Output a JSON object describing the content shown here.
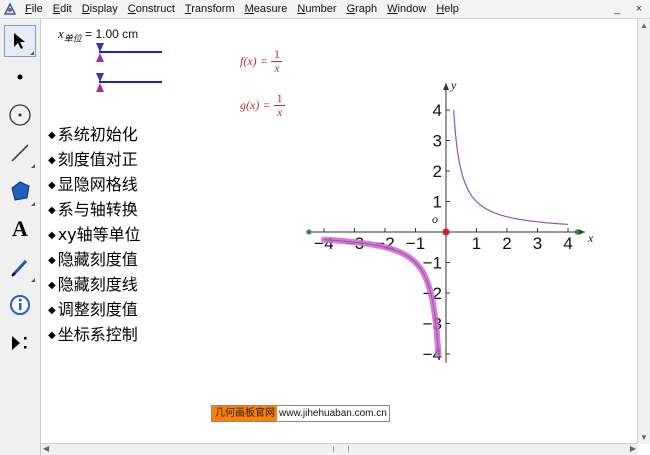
{
  "menu": {
    "items": [
      {
        "label": "File",
        "u": "F",
        "rest": "ile"
      },
      {
        "label": "Edit",
        "u": "E",
        "rest": "dit"
      },
      {
        "label": "Display",
        "u": "D",
        "rest": "isplay"
      },
      {
        "label": "Construct",
        "u": "C",
        "rest": "onstruct"
      },
      {
        "label": "Transform",
        "u": "T",
        "rest": "ransform"
      },
      {
        "label": "Measure",
        "u": "M",
        "rest": "easure"
      },
      {
        "label": "Number",
        "u": "N",
        "rest": "umber"
      },
      {
        "label": "Graph",
        "u": "G",
        "rest": "raph"
      },
      {
        "label": "Window",
        "u": "W",
        "rest": "indow"
      },
      {
        "label": "Help",
        "u": "H",
        "rest": "elp"
      }
    ],
    "win_min": "_",
    "win_close": "×"
  },
  "tools": [
    "arrow-select",
    "point",
    "compass",
    "straightedge",
    "polygon",
    "text",
    "marker",
    "information",
    "custom-tools"
  ],
  "tool_text_glyph": "A",
  "unit": {
    "var": "x",
    "sub": "单位",
    "value": "= 1.00 cm"
  },
  "buttons": [
    "系统初始化",
    "刻度值对正",
    "显隐网格线",
    "系与轴转换",
    "xy轴等单位",
    "隐藏刻度值",
    "隐藏刻度线",
    "调整刻度值",
    "坐标系控制"
  ],
  "bullet": "◆",
  "functions": {
    "f": {
      "name": "f(x)",
      "eq": "=",
      "num": "1",
      "den": "x"
    },
    "g": {
      "name": "g(x)",
      "eq": "=",
      "num": "1",
      "den": "x"
    }
  },
  "watermark": {
    "part1": "几何画板官网",
    "part2": "www.jihehuaban.com.cn"
  },
  "chart_data": {
    "type": "line",
    "xlabel": "x",
    "ylabel": "y",
    "origin_label": "o",
    "xlim": [
      -4.1,
      4.1
    ],
    "ylim": [
      -4.1,
      4.1
    ],
    "x_ticks": [
      -4,
      -3,
      -2,
      -1,
      1,
      2,
      3,
      4
    ],
    "y_ticks": [
      -4,
      -3,
      -2,
      -1,
      1,
      2,
      3,
      4
    ],
    "x_tick_labels": [
      "−4",
      "−3",
      "−2",
      "−1",
      "1",
      "2",
      "3",
      "4"
    ],
    "y_tick_labels": [
      "−4",
      "−3",
      "−2",
      "−1",
      "1",
      "2",
      "3",
      "4"
    ],
    "series": [
      {
        "formula": "1/x",
        "domain": [
          0.25,
          4
        ],
        "color": "#9a4fb0",
        "width": "thin"
      },
      {
        "formula": "1/x",
        "domain": [
          -4,
          -0.25
        ],
        "color": "#cc66cc",
        "width": "thick"
      }
    ],
    "origin_point_color": "#cc2222",
    "axis_end_point_color": "#2e8b2e"
  }
}
